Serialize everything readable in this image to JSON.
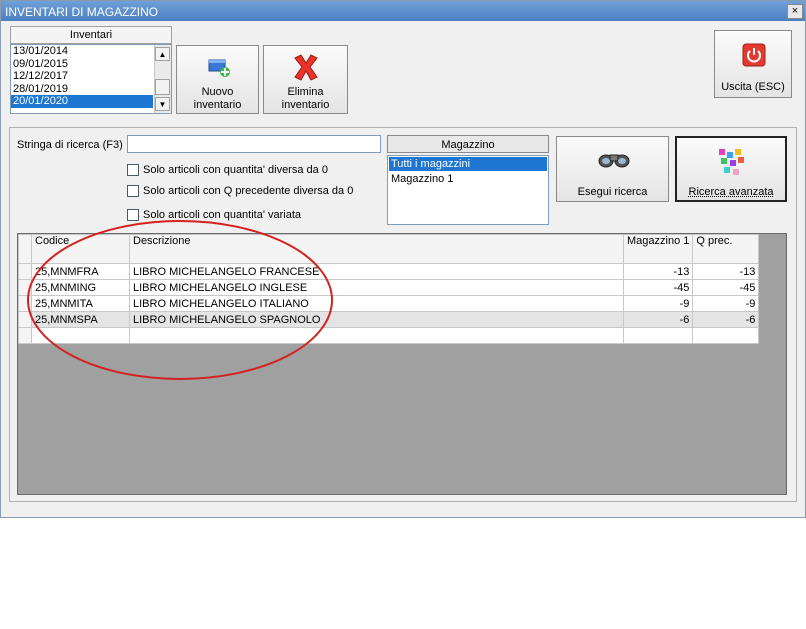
{
  "window": {
    "title": "INVENTARI DI MAGAZZINO",
    "close_glyph": "×"
  },
  "inventari": {
    "header": "Inventari",
    "items": [
      {
        "label": "13/01/2014",
        "selected": false
      },
      {
        "label": "09/01/2015",
        "selected": false
      },
      {
        "label": "12/12/2017",
        "selected": false
      },
      {
        "label": "28/01/2019",
        "selected": false
      },
      {
        "label": "20/01/2020",
        "selected": true
      }
    ]
  },
  "toolbar": {
    "nuovo_line1": "Nuovo",
    "nuovo_line2": "inventario",
    "elimina_line1": "Elimina",
    "elimina_line2": "inventario",
    "uscita": "Uscita (ESC)"
  },
  "search": {
    "label": "Stringa di ricerca (F3)",
    "value": "",
    "options": [
      "Solo articoli con quantita' diversa da 0",
      "Solo articoli con Q precedente diversa da 0",
      "Solo articoli con quantita' variata"
    ],
    "esegui": "Esegui ricerca",
    "avanzata": "Ricerca avanzata"
  },
  "magazzino": {
    "header": "Magazzino",
    "items": [
      {
        "label": "Tutti i magazzini",
        "selected": true
      },
      {
        "label": "Magazzino 1",
        "selected": false
      }
    ]
  },
  "grid": {
    "columns": [
      "Codice",
      "Descrizione",
      "Magazzino 1",
      "Q prec."
    ],
    "rows": [
      {
        "codice": "25,MNMFRA",
        "descrizione": "LIBRO MICHELANGELO FRANCESE",
        "mag1": "-13",
        "qprec": "-13"
      },
      {
        "codice": "25,MNMING",
        "descrizione": "LIBRO MICHELANGELO INGLESE",
        "mag1": "-45",
        "qprec": "-45"
      },
      {
        "codice": "25,MNMITA",
        "descrizione": "LIBRO MICHELANGELO ITALIANO",
        "mag1": "-9",
        "qprec": "-9"
      },
      {
        "codice": "25,MNMSPA",
        "descrizione": "LIBRO MICHELANGELO SPAGNOLO",
        "mag1": "-6",
        "qprec": "-6"
      }
    ]
  },
  "colors": {
    "selection": "#1c76d2",
    "titlebar": "#4a7fc0",
    "annotation": "#d42020"
  }
}
